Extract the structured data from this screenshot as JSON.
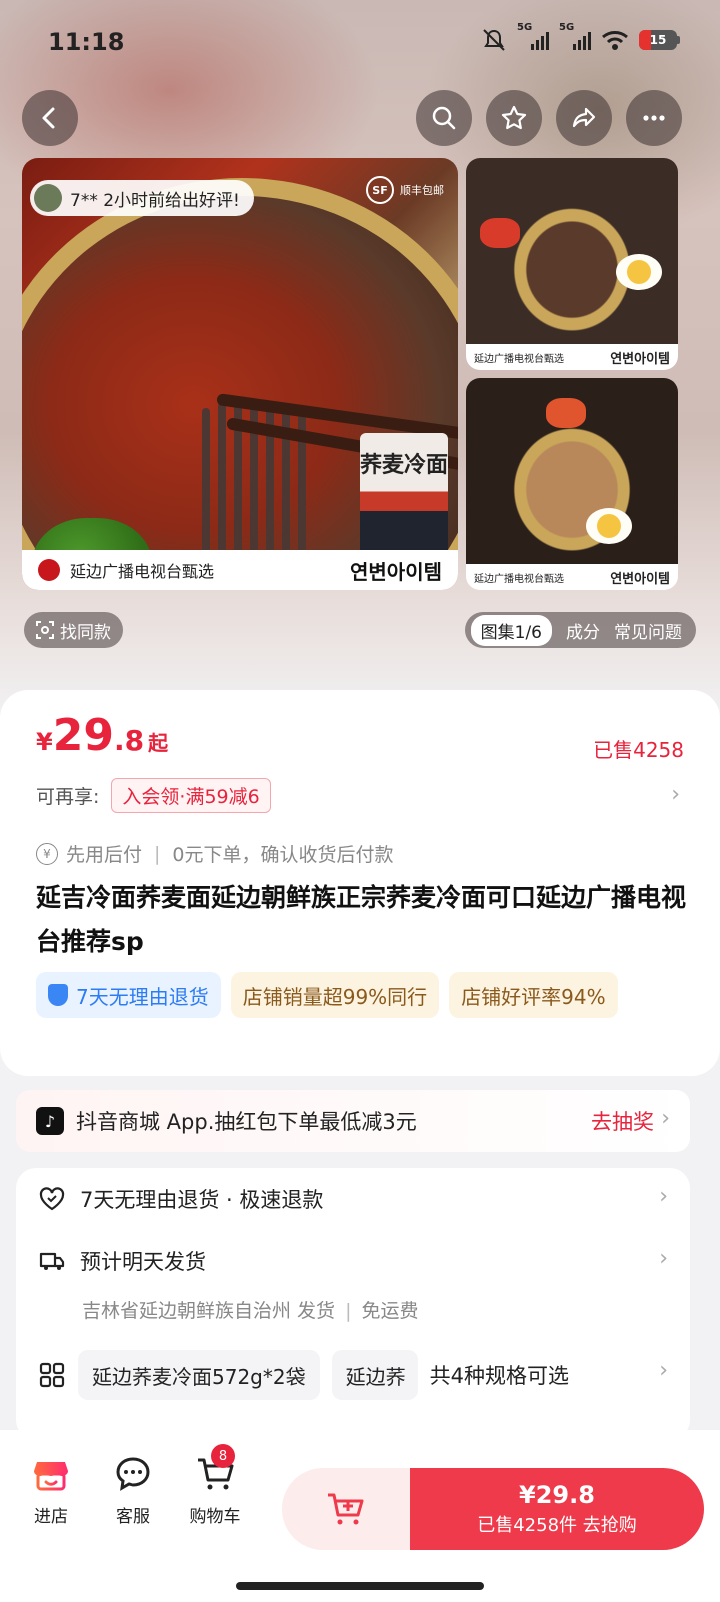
{
  "status_bar": {
    "time": "11:18",
    "signal_1_label": "5G",
    "signal_2_label": "5G",
    "battery": "15"
  },
  "top_actions": [
    "back",
    "search",
    "favorite",
    "share",
    "more"
  ],
  "gallery": {
    "review_text": "7** 2小时前给出好评!",
    "sf_label": "顺丰包邮",
    "main_caption_left": "延边广播电视台甄选",
    "main_caption_right": "연변아이템",
    "side_caption_left": "延边广播电视台甄选",
    "side_caption_right": "연변아이템",
    "pack_label": "荞麦冷面",
    "find_same": "找同款",
    "nav": [
      "图集1/6",
      "成分",
      "常见问题"
    ]
  },
  "product": {
    "currency": "¥",
    "price_int": "29",
    "price_dec": ".8",
    "price_suffix": "起",
    "sold": "已售4258",
    "coupon_label": "可再享:",
    "coupon_tag": "入会领·满59减6",
    "paylater_a": "先用后付",
    "paylater_b": "0元下单，确认收货后付款",
    "title": "延吉冷面荞麦面延边朝鲜族正宗荞麦冷面可口延边广播电视台推荐sp",
    "badges": [
      "7天无理由退货",
      "店铺销量超99%同行",
      "店铺好评率94%"
    ]
  },
  "lottery": {
    "text": "抖音商城 App.抽红包下单最低减3元",
    "action": "去抽奖"
  },
  "service": {
    "refund": "7天无理由退货 · 极速退款",
    "shipping": "预计明天发货",
    "origin": "吉林省延边朝鲜族自治州 发货",
    "freight": "免运费",
    "spec_chip_1": "延边荞麦冷面572g*2袋",
    "spec_chip_2": "延边荞",
    "spec_more": "共4种规格可选"
  },
  "bottom_bar": {
    "store": "进店",
    "service": "客服",
    "cart": "购物车",
    "cart_count": "8",
    "buy_price": "¥29.8",
    "buy_sub": "已售4258件  去抢购"
  },
  "colors": {
    "accent": "#e8233c",
    "buy_button": "#ee3a4a",
    "add_cart_bg": "#fdecec"
  }
}
